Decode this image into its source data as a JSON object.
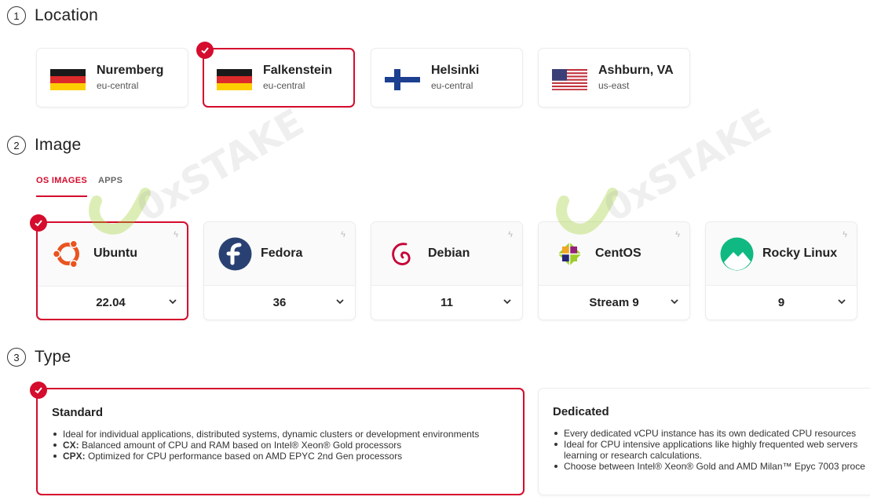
{
  "location": {
    "step": "1",
    "title": "Location",
    "items": [
      {
        "name": "Nuremberg",
        "zone": "eu-central",
        "flag": "de-flag-icon"
      },
      {
        "name": "Falkenstein",
        "zone": "eu-central",
        "flag": "de-flag-icon",
        "selected": true
      },
      {
        "name": "Helsinki",
        "zone": "eu-central",
        "flag": "fi-flag-icon"
      },
      {
        "name": "Ashburn, VA",
        "zone": "us-east",
        "flag": "us-flag-icon"
      }
    ]
  },
  "image": {
    "step": "2",
    "title": "Image",
    "tabs": [
      {
        "label": "OS IMAGES",
        "active": true
      },
      {
        "label": "APPS",
        "active": false
      }
    ],
    "items": [
      {
        "name": "Ubuntu",
        "version": "22.04",
        "selected": true
      },
      {
        "name": "Fedora",
        "version": "36"
      },
      {
        "name": "Debian",
        "version": "11"
      },
      {
        "name": "CentOS",
        "version": "Stream 9"
      },
      {
        "name": "Rocky Linux",
        "version": "9"
      }
    ]
  },
  "type": {
    "step": "3",
    "title": "Type",
    "items": [
      {
        "title": "Standard",
        "selected": true,
        "bullets": [
          {
            "bold": "",
            "text": "Ideal for individual applications, distributed systems, dynamic clusters or development environments"
          },
          {
            "bold": "CX:",
            "text": " Balanced amount of CPU and RAM based on Intel® Xeon® Gold processors"
          },
          {
            "bold": "CPX:",
            "text": " Optimized for CPU performance based on AMD EPYC 2nd Gen processors"
          }
        ]
      },
      {
        "title": "Dedicated",
        "bullets": [
          {
            "bold": "",
            "text": "Every dedicated vCPU instance has its own dedicated CPU resources"
          },
          {
            "bold": "",
            "text": "Ideal for CPU intensive applications like highly frequented web servers"
          },
          {
            "bold": "",
            "text": "learning or research calculations."
          },
          {
            "bold": "",
            "text": "Choose between Intel® Xeon® Gold and AMD Milan™ Epyc 7003 proce"
          }
        ]
      }
    ]
  },
  "watermark": {
    "text": "0xSTAKE"
  },
  "colors": {
    "accent": "#d50c2d"
  }
}
